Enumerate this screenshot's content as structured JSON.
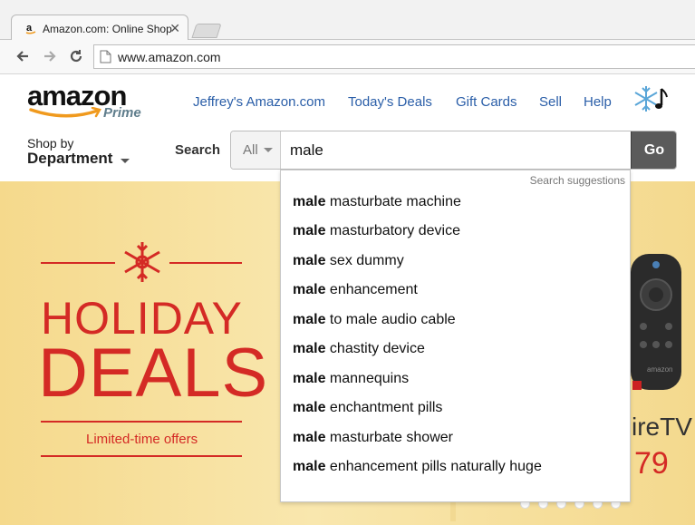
{
  "browser": {
    "tab_title": "Amazon.com: Online Shop",
    "url": "www.amazon.com"
  },
  "header": {
    "logo_word": "amazon",
    "logo_prime": "Prime",
    "links": [
      "Jeffrey's Amazon.com",
      "Today's Deals",
      "Gift Cards",
      "Sell",
      "Help"
    ],
    "shop_by": "Shop by",
    "department": "Department",
    "search_label": "Search",
    "search_category": "All",
    "search_value": "male",
    "go_label": "Go"
  },
  "suggestions": {
    "header": "Search suggestions",
    "prefix": "male",
    "items": [
      " masturbate machine",
      " masturbatory device",
      " sex dummy",
      " enhancement",
      " to male audio cable",
      " chastity device",
      " mannequins",
      " enchantment pills",
      " masturbate shower",
      " enhancement pills naturally huge"
    ]
  },
  "banner": {
    "line1": "HOLIDAY",
    "line2": "DEALS",
    "subtitle": "Limited-time offers",
    "product_name": "ireTV",
    "product_price": "79",
    "carousel_dots": 6
  },
  "colors": {
    "link": "#2a5ea8",
    "holiday_red": "#d42a25",
    "go_button": "#5b5b5b",
    "banner_gold": "#f5d98c"
  }
}
